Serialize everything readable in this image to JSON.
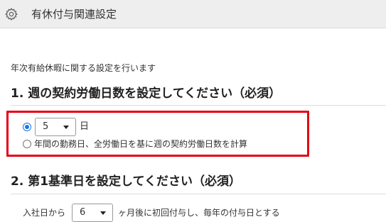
{
  "header": {
    "title": "有休付与関連設定",
    "icon": "gear-icon"
  },
  "intro": "年次有給休暇に関する設定を行います",
  "section1": {
    "title": "1. 週の契約労働日数を設定してください（必須）",
    "option1": {
      "selected": true,
      "days_value": "5",
      "unit": "日"
    },
    "option2": {
      "selected": false,
      "label": "年間の勤務日、全労働日を基に週の契約労働日数を計算"
    }
  },
  "section2": {
    "title": "2. 第1基準日を設定してください（必須）",
    "prefix": "入社日から",
    "months_value": "6",
    "suffix": "ヶ月後に初回付与し、毎年の付与日とする"
  },
  "colors": {
    "highlight": "#e60012",
    "radio_accent": "#1a73e8",
    "header_bg": "#eeeeee"
  }
}
